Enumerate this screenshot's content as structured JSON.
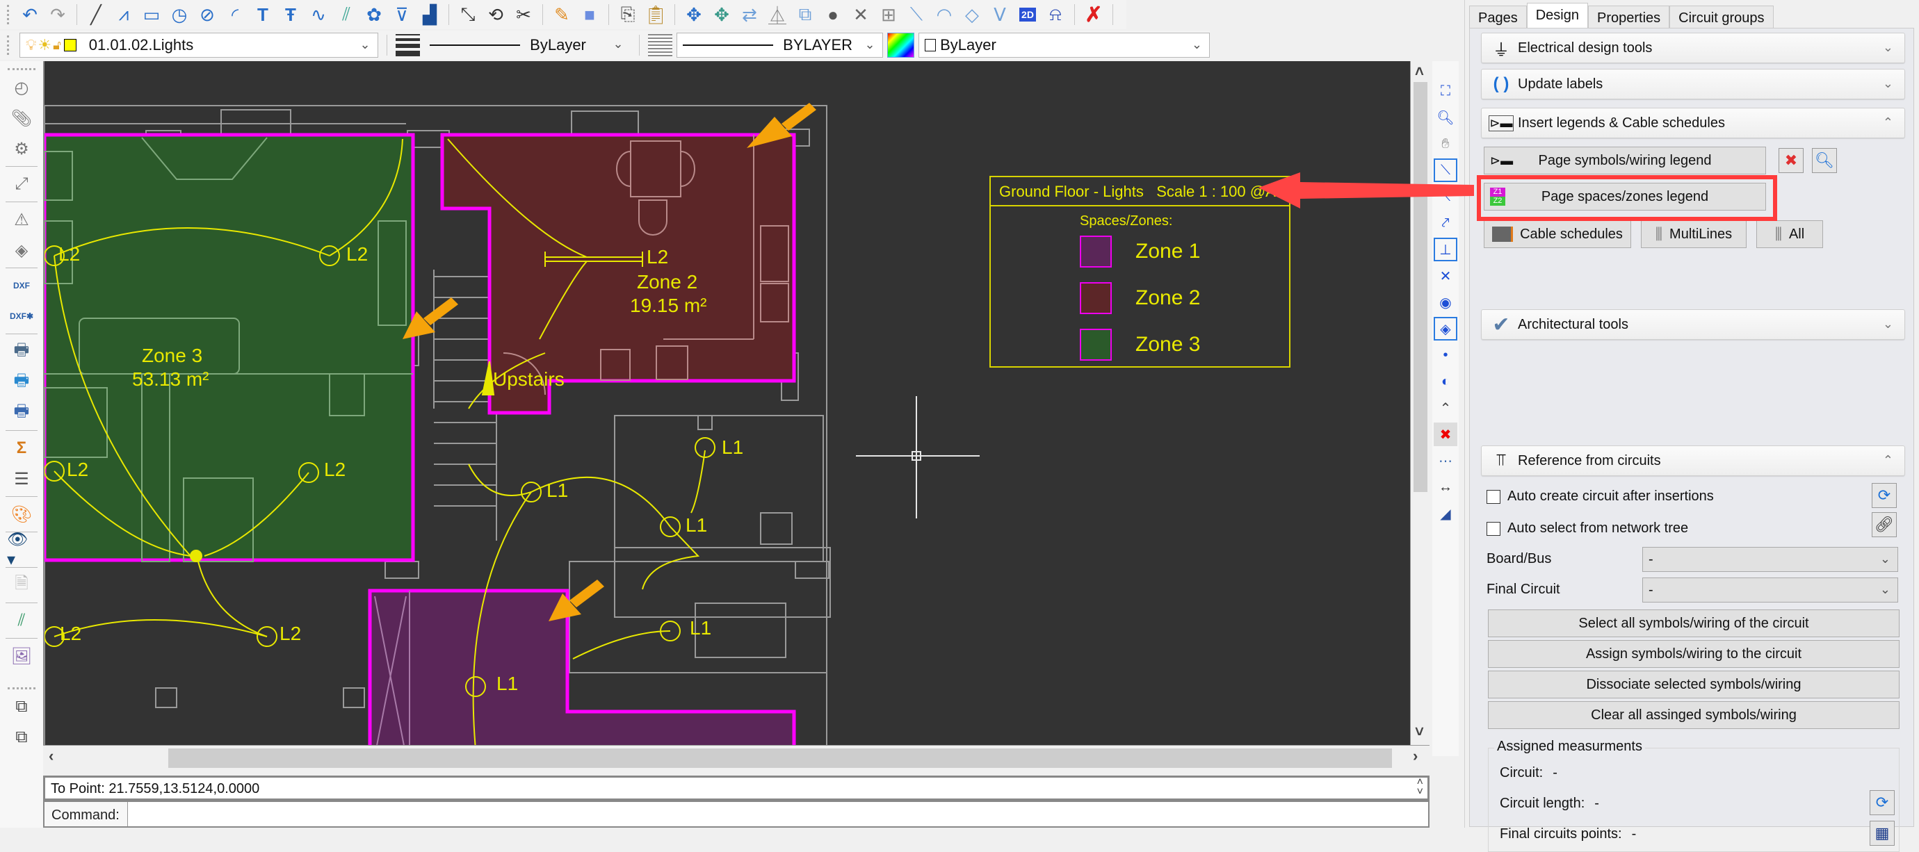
{
  "toolbar": {
    "top_icons": [
      "undo-icon",
      "redo-icon",
      "line-icon",
      "polyline-icon",
      "rectangle-icon",
      "circle-icon",
      "ellipse-icon",
      "arc-icon",
      "text-icon",
      "mtext-icon",
      "spline-icon",
      "hatch-icon",
      "revision-cloud-icon",
      "wipeout-icon",
      "image-icon",
      "stretch-icon",
      "rotate-icon",
      "explode-icon",
      "edit-icon",
      "fill-icon",
      "copy-icon",
      "paste-icon",
      "move-icon",
      "copy-move-icon",
      "rotate-copy-icon",
      "mirror-icon",
      "scale-icon",
      "erase-icon",
      "trim-icon",
      "grid-icon",
      "extend-icon",
      "fillet-icon",
      "chamfer-icon",
      "break-icon",
      "2d-icon",
      "dimension-icon",
      "delete-icon"
    ],
    "layer": "01.01.02.Lights",
    "lineweight": "ByLayer",
    "linetype": "BYLAYER",
    "color": "ByLayer"
  },
  "canvas": {
    "legend": {
      "title": "Ground Floor - Lights   Scale 1 : 100 @A4",
      "subtitle": "Spaces/Zones:",
      "zones": [
        {
          "label": "Zone 1",
          "color": "#5a2658"
        },
        {
          "label": "Zone 2",
          "color": "#5c2628"
        },
        {
          "label": "Zone 3",
          "color": "#2b5a2a"
        }
      ]
    },
    "zones": [
      {
        "name": "Zone 3",
        "area": "53.13 m²",
        "color": "#2b5a2a"
      },
      {
        "name": "Zone 2",
        "area": "19.15 m²",
        "color": "#5c2628"
      },
      {
        "name": "Zone 1",
        "area": "",
        "color": "#5a2658"
      }
    ],
    "circuit_labels": [
      "L2",
      "L2",
      "L2",
      "L2",
      "L2",
      "L2",
      "L2",
      "L1",
      "L1",
      "L1",
      "L1",
      "L1"
    ],
    "upstairs_label": "Upstairs",
    "zone_border_color": "#ff00ff",
    "wiring_color": "#e8e800",
    "callout_arrow_color": "#f5a30a",
    "highlight_color": "#ff3b3b"
  },
  "status": {
    "point": "To Point: 21.7559,13.5124,0.0000",
    "command_label": "Command:",
    "command_value": ""
  },
  "panel": {
    "tabs": [
      {
        "label": "Pages",
        "active": false
      },
      {
        "label": "Design",
        "active": true
      },
      {
        "label": "Properties",
        "active": false
      },
      {
        "label": "Circuit groups",
        "active": false
      }
    ],
    "sections": {
      "electrical": "Electrical design tools",
      "update_labels": "Update labels",
      "legends": "Insert legends & Cable schedules",
      "architectural": "Architectural tools",
      "reference": "Reference from circuits"
    },
    "legend_buttons": {
      "symbols_wiring": "Page symbols/wiring legend",
      "spaces_zones": "Page spaces/zones legend",
      "cable_schedules": "Cable schedules",
      "multilines": "MultiLines",
      "all": "All"
    },
    "reference": {
      "auto_create": {
        "label": "Auto create circuit after insertions",
        "checked": false
      },
      "auto_select": {
        "label": "Auto select from network tree",
        "checked": false
      },
      "board_bus": {
        "label": "Board/Bus",
        "value": "-"
      },
      "final_circuit": {
        "label": "Final Circuit",
        "value": "-"
      },
      "buttons": [
        "Select all symbols/wiring of the circuit",
        "Assign symbols/wiring to the circuit",
        "Dissociate selected symbols/wiring",
        "Clear all assinged symbols/wiring"
      ]
    },
    "measurements": {
      "title": "Assigned measurments",
      "circuit": {
        "label": "Circuit:",
        "value": "-"
      },
      "length": {
        "label": "Circuit length:",
        "value": "-"
      },
      "points": {
        "label": "Final circuits points:",
        "value": "-"
      }
    }
  }
}
